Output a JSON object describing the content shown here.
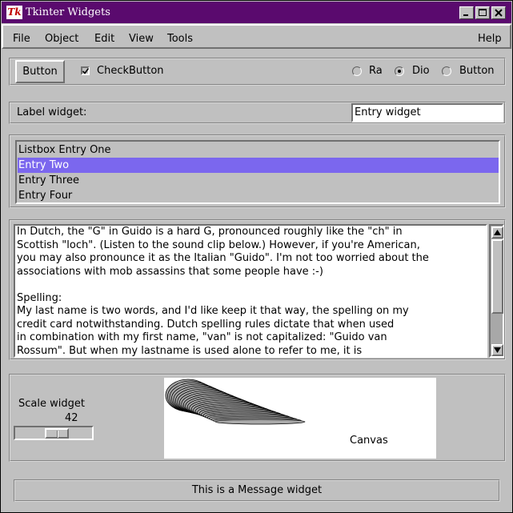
{
  "window": {
    "title": "Tkinter Widgets",
    "logo_text": "Tk"
  },
  "menubar": {
    "items": [
      "File",
      "Object",
      "Edit",
      "View",
      "Tools"
    ],
    "help": "Help"
  },
  "toolbar": {
    "button_label": "Button",
    "checkbutton_label": "CheckButton",
    "checkbutton_checked": true,
    "radios": [
      {
        "label": "Ra",
        "selected": false
      },
      {
        "label": "Dio",
        "selected": true
      },
      {
        "label": "Button",
        "selected": false
      }
    ]
  },
  "label_row": {
    "label": "Label widget:",
    "entry_value": "Entry widget"
  },
  "listbox": {
    "items": [
      "Listbox Entry One",
      "Entry Two",
      "Entry Three",
      "Entry Four"
    ],
    "selected_index": 1,
    "selection_color": "#7b67ee"
  },
  "text_widget": {
    "lines": [
      "In Dutch, the \"G\" in Guido is a hard G, pronounced roughly like the \"ch\" in",
      "Scottish \"loch\". (Listen to the sound clip below.) However, if you're American,",
      "you may also pronounce it as the Italian \"Guido\". I'm not too worried about the",
      "associations with mob assassins that some people have :-)",
      "",
      "Spelling:",
      "My last name is two words, and I'd like keep it that way, the spelling on my",
      "credit card notwithstanding. Dutch spelling rules dictate that when used",
      "in combination with my first name, \"van\" is not capitalized: \"Guido van",
      "Rossum\". But when my lastname is used alone to refer to me, it is"
    ]
  },
  "scale": {
    "label": "Scale widget",
    "value": "42",
    "fraction": 0.42
  },
  "canvas": {
    "label": "Canvas",
    "shape_color": "#a8a8a8"
  },
  "message": {
    "text": "This is a Message widget"
  },
  "colors": {
    "background": "#c0c0c0",
    "titlebar": "#5a0a6e"
  }
}
